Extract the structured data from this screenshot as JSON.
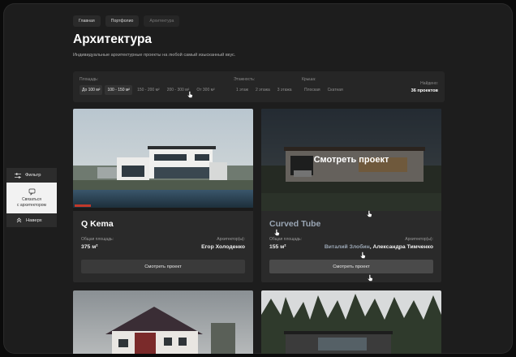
{
  "breadcrumb": [
    {
      "label": "Главная"
    },
    {
      "label": "Портфолио"
    },
    {
      "label": "Архитектура"
    }
  ],
  "page": {
    "title": "Архитектура",
    "subtitle": "Индивидуальные архитектурные проекты на любой самый изысканный вкус."
  },
  "filters": {
    "area": {
      "label": "Площадь:",
      "options": [
        "До 100 м²",
        "100 - 150 м²",
        "150 - 200 м²",
        "200 - 300 м²",
        "От 300 м²"
      ],
      "active": [
        0,
        1
      ]
    },
    "floors": {
      "label": "Этажность:",
      "options": [
        "1 этаж",
        "2 этажа",
        "3 этажа"
      ]
    },
    "roof": {
      "label": "Крыша:",
      "options": [
        "Плоская",
        "Скатная"
      ]
    },
    "found": {
      "label": "Найдено:",
      "value": "36 проектов"
    }
  },
  "cards": [
    {
      "name": "Q Kema",
      "area_label": "Общая площадь:",
      "area_value": "375 м²",
      "architect_label": "Архитектор(ы):",
      "architect_value": "Егор Холоденко",
      "button": "Смотреть проект"
    },
    {
      "name": "Curved Tube",
      "area_label": "Общая площадь:",
      "area_value": "155 м²",
      "architect_label": "Архитектор(ы):",
      "architect_value_1": "Виталий Злобин",
      "architect_sep": ", ",
      "architect_value_2": "Александра Тимченко",
      "button": "Смотреть проект",
      "overlay": "Смотреть проект"
    }
  ],
  "side_panel": {
    "filter_label": "Фильтр",
    "contact_line1": "Связаться",
    "contact_line2": "с архитектором",
    "top_label": "Наверх"
  },
  "icons": [
    "sliders-icon",
    "chat-icon",
    "chevrons-up-icon",
    "cursor-icon"
  ],
  "colors": {
    "background": "#1d1d1d",
    "panel": "#262626",
    "card": "#2a2a2a",
    "accent_text": "#ffffff"
  }
}
